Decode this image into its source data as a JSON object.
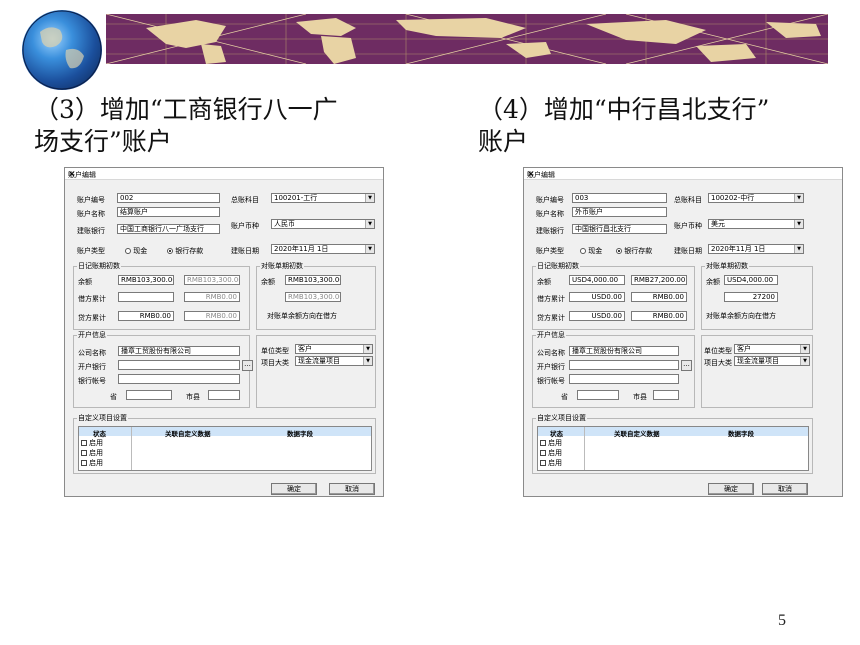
{
  "captions": {
    "left": "（3）增加“工商银行八一广\n场支行”账户",
    "right": "（4）增加“中行昌北支行”\n账户"
  },
  "page_number": "5",
  "dialogs": [
    {
      "title": "账户编辑",
      "close": "✕",
      "account_no_label": "账户编号",
      "account_no": "002",
      "ledger_label": "总账科目",
      "ledger": "100201-工行",
      "account_name_label": "账户名称",
      "account_name": "结算账户",
      "bank_label": "建账银行",
      "bank": "中国工商银行八一广场支行",
      "currency_label": "账户币种",
      "currency": "人民币",
      "type_label": "账户类型",
      "cash": "现金",
      "deposit": "银行存款",
      "date_label": "建账日期",
      "date": "2020年11月 1日",
      "journal_group": "日记账期初数",
      "recon_group": "对账单期初数",
      "balance_label": "余额",
      "balance": "RMB103,300.00",
      "balance2": "RMB103,300.00",
      "recon_balance": "RMB103,300.00",
      "recon_balance2": "RMB103,300.00",
      "debit_label": "借方累计",
      "debit": "",
      "debit2": "RMB0.00",
      "credit_label": "贷方累计",
      "credit": "RMB0.00",
      "credit2": "RMB0.00",
      "recon_note": "对账单余额方向在借方",
      "open_group": "开户信息",
      "company_label": "公司名称",
      "company": "播章工贸股份有限公司",
      "open_bank_label": "开户银行",
      "open_bank": "",
      "bank_acct_label": "银行帐号",
      "province_label": "省",
      "city_label": "市县",
      "unit_type_label": "单位类型",
      "unit_type": "客户",
      "item_class_label": "项目大类",
      "item_class": "现金流量项目",
      "dots": "...",
      "custom_group": "自定义项目设置",
      "col_status": "状态",
      "col_custom": "关联自定义数据",
      "col_field": "数据字段",
      "enable": [
        "启用",
        "启用",
        "启用"
      ],
      "ok": "确定",
      "cancel": "取消"
    },
    {
      "title": "账户编辑",
      "close": "✕",
      "account_no_label": "账户编号",
      "account_no": "003",
      "ledger_label": "总账科目",
      "ledger": "100202-中行",
      "account_name_label": "账户名称",
      "account_name": "外币账户",
      "bank_label": "建账银行",
      "bank": "中国银行昌北支行",
      "currency_label": "账户币种",
      "currency": "美元",
      "type_label": "账户类型",
      "cash": "现金",
      "deposit": "银行存款",
      "date_label": "建账日期",
      "date": "2020年11月 1日",
      "journal_group": "日记账期初数",
      "recon_group": "对账单期初数",
      "balance_label": "余额",
      "balance": "USD4,000.00",
      "balance2": "RMB27,200.00",
      "recon_balance": "USD4,000.00",
      "recon_balance2": "27200",
      "debit_label": "借方累计",
      "debit": "USD0.00",
      "debit2": "RMB0.00",
      "credit_label": "贷方累计",
      "credit": "USD0.00",
      "credit2": "RMB0.00",
      "recon_note": "对账单余额方向在借方",
      "open_group": "开户信息",
      "company_label": "公司名称",
      "company": "播章工贸股份有限公司",
      "open_bank_label": "开户银行",
      "open_bank": "",
      "bank_acct_label": "银行帐号",
      "province_label": "省",
      "city_label": "市县",
      "unit_type_label": "单位类型",
      "unit_type": "客户",
      "item_class_label": "项目大类",
      "item_class": "现金流量项目",
      "dots": "...",
      "custom_group": "自定义项目设置",
      "col_status": "状态",
      "col_custom": "关联自定义数据",
      "col_field": "数据字段",
      "enable": [
        "启用",
        "启用",
        "启用"
      ],
      "ok": "确定",
      "cancel": "取消"
    }
  ]
}
